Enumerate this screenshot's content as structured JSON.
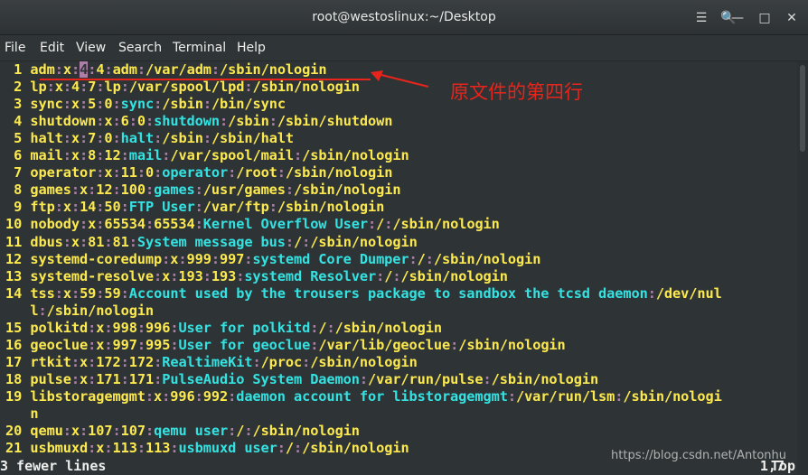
{
  "window": {
    "title": "root@westoslinux:~/Desktop",
    "controls": [
      "search-icon",
      "menu-icon",
      "minimize-icon",
      "maximize-icon",
      "close-icon"
    ]
  },
  "menu": [
    "File",
    "Edit",
    "View",
    "Search",
    "Terminal",
    "Help"
  ],
  "annotation": {
    "text": "原文件的第四行",
    "color": "#e8241b"
  },
  "lines": [
    {
      "n": "1",
      "parts": [
        [
          "adm",
          "user"
        ],
        [
          ":",
          "col"
        ],
        [
          "x",
          "user"
        ],
        [
          ":",
          "col"
        ],
        [
          "4",
          "cursor"
        ],
        [
          ":",
          "col"
        ],
        [
          "4",
          "user"
        ],
        [
          ":",
          "col"
        ],
        [
          "adm",
          "user"
        ],
        [
          ":",
          "col"
        ],
        [
          "/var/adm",
          "user"
        ],
        [
          ":",
          "col"
        ],
        [
          "/sbin/nologin",
          "user"
        ]
      ]
    },
    {
      "n": "2",
      "parts": [
        [
          "lp",
          "user"
        ],
        [
          ":",
          "col"
        ],
        [
          "x",
          "user"
        ],
        [
          ":",
          "col"
        ],
        [
          "4",
          "user"
        ],
        [
          ":",
          "col"
        ],
        [
          "7",
          "user"
        ],
        [
          ":",
          "col"
        ],
        [
          "lp",
          "user"
        ],
        [
          ":",
          "col"
        ],
        [
          "/var/spool/lpd",
          "user"
        ],
        [
          ":",
          "col"
        ],
        [
          "/sbin/nologin",
          "user"
        ]
      ]
    },
    {
      "n": "3",
      "parts": [
        [
          "sync",
          "user"
        ],
        [
          ":",
          "col"
        ],
        [
          "x",
          "user"
        ],
        [
          ":",
          "col"
        ],
        [
          "5",
          "user"
        ],
        [
          ":",
          "col"
        ],
        [
          "0",
          "user"
        ],
        [
          ":",
          "col"
        ],
        [
          "sync",
          "text"
        ],
        [
          ":",
          "col"
        ],
        [
          "/sbin",
          "user"
        ],
        [
          ":",
          "col"
        ],
        [
          "/bin/sync",
          "user"
        ]
      ]
    },
    {
      "n": "4",
      "parts": [
        [
          "shutdown",
          "user"
        ],
        [
          ":",
          "col"
        ],
        [
          "x",
          "user"
        ],
        [
          ":",
          "col"
        ],
        [
          "6",
          "user"
        ],
        [
          ":",
          "col"
        ],
        [
          "0",
          "user"
        ],
        [
          ":",
          "col"
        ],
        [
          "shutdown",
          "text"
        ],
        [
          ":",
          "col"
        ],
        [
          "/sbin",
          "user"
        ],
        [
          ":",
          "col"
        ],
        [
          "/sbin/shutdown",
          "user"
        ]
      ]
    },
    {
      "n": "5",
      "parts": [
        [
          "halt",
          "user"
        ],
        [
          ":",
          "col"
        ],
        [
          "x",
          "user"
        ],
        [
          ":",
          "col"
        ],
        [
          "7",
          "user"
        ],
        [
          ":",
          "col"
        ],
        [
          "0",
          "user"
        ],
        [
          ":",
          "col"
        ],
        [
          "halt",
          "text"
        ],
        [
          ":",
          "col"
        ],
        [
          "/sbin",
          "user"
        ],
        [
          ":",
          "col"
        ],
        [
          "/sbin/halt",
          "user"
        ]
      ]
    },
    {
      "n": "6",
      "parts": [
        [
          "mail",
          "user"
        ],
        [
          ":",
          "col"
        ],
        [
          "x",
          "user"
        ],
        [
          ":",
          "col"
        ],
        [
          "8",
          "user"
        ],
        [
          ":",
          "col"
        ],
        [
          "12",
          "user"
        ],
        [
          ":",
          "col"
        ],
        [
          "mail",
          "text"
        ],
        [
          ":",
          "col"
        ],
        [
          "/var/spool/mail",
          "user"
        ],
        [
          ":",
          "col"
        ],
        [
          "/sbin/nologin",
          "user"
        ]
      ]
    },
    {
      "n": "7",
      "parts": [
        [
          "operator",
          "user"
        ],
        [
          ":",
          "col"
        ],
        [
          "x",
          "user"
        ],
        [
          ":",
          "col"
        ],
        [
          "11",
          "user"
        ],
        [
          ":",
          "col"
        ],
        [
          "0",
          "user"
        ],
        [
          ":",
          "col"
        ],
        [
          "operator",
          "text"
        ],
        [
          ":",
          "col"
        ],
        [
          "/root",
          "user"
        ],
        [
          ":",
          "col"
        ],
        [
          "/sbin/nologin",
          "user"
        ]
      ]
    },
    {
      "n": "8",
      "parts": [
        [
          "games",
          "user"
        ],
        [
          ":",
          "col"
        ],
        [
          "x",
          "user"
        ],
        [
          ":",
          "col"
        ],
        [
          "12",
          "user"
        ],
        [
          ":",
          "col"
        ],
        [
          "100",
          "user"
        ],
        [
          ":",
          "col"
        ],
        [
          "games",
          "text"
        ],
        [
          ":",
          "col"
        ],
        [
          "/usr/games",
          "user"
        ],
        [
          ":",
          "col"
        ],
        [
          "/sbin/nologin",
          "user"
        ]
      ]
    },
    {
      "n": "9",
      "parts": [
        [
          "ftp",
          "user"
        ],
        [
          ":",
          "col"
        ],
        [
          "x",
          "user"
        ],
        [
          ":",
          "col"
        ],
        [
          "14",
          "user"
        ],
        [
          ":",
          "col"
        ],
        [
          "50",
          "user"
        ],
        [
          ":",
          "col"
        ],
        [
          "FTP User",
          "text"
        ],
        [
          ":",
          "col"
        ],
        [
          "/var/ftp",
          "user"
        ],
        [
          ":",
          "col"
        ],
        [
          "/sbin/nologin",
          "user"
        ]
      ]
    },
    {
      "n": "10",
      "parts": [
        [
          "nobody",
          "user"
        ],
        [
          ":",
          "col"
        ],
        [
          "x",
          "user"
        ],
        [
          ":",
          "col"
        ],
        [
          "65534",
          "user"
        ],
        [
          ":",
          "col"
        ],
        [
          "65534",
          "user"
        ],
        [
          ":",
          "col"
        ],
        [
          "Kernel Overflow User",
          "text"
        ],
        [
          ":",
          "col"
        ],
        [
          "/",
          "user"
        ],
        [
          ":",
          "col"
        ],
        [
          "/sbin/nologin",
          "user"
        ]
      ]
    },
    {
      "n": "11",
      "parts": [
        [
          "dbus",
          "user"
        ],
        [
          ":",
          "col"
        ],
        [
          "x",
          "user"
        ],
        [
          ":",
          "col"
        ],
        [
          "81",
          "user"
        ],
        [
          ":",
          "col"
        ],
        [
          "81",
          "user"
        ],
        [
          ":",
          "col"
        ],
        [
          "System message bus",
          "text"
        ],
        [
          ":",
          "col"
        ],
        [
          "/",
          "user"
        ],
        [
          ":",
          "col"
        ],
        [
          "/sbin/nologin",
          "user"
        ]
      ]
    },
    {
      "n": "12",
      "parts": [
        [
          "systemd-coredump",
          "user"
        ],
        [
          ":",
          "col"
        ],
        [
          "x",
          "user"
        ],
        [
          ":",
          "col"
        ],
        [
          "999",
          "user"
        ],
        [
          ":",
          "col"
        ],
        [
          "997",
          "user"
        ],
        [
          ":",
          "col"
        ],
        [
          "systemd Core Dumper",
          "text"
        ],
        [
          ":",
          "col"
        ],
        [
          "/",
          "user"
        ],
        [
          ":",
          "col"
        ],
        [
          "/sbin/nologin",
          "user"
        ]
      ]
    },
    {
      "n": "13",
      "parts": [
        [
          "systemd-resolve",
          "user"
        ],
        [
          ":",
          "col"
        ],
        [
          "x",
          "user"
        ],
        [
          ":",
          "col"
        ],
        [
          "193",
          "user"
        ],
        [
          ":",
          "col"
        ],
        [
          "193",
          "user"
        ],
        [
          ":",
          "col"
        ],
        [
          "systemd Resolver",
          "text"
        ],
        [
          ":",
          "col"
        ],
        [
          "/",
          "user"
        ],
        [
          ":",
          "col"
        ],
        [
          "/sbin/nologin",
          "user"
        ]
      ]
    },
    {
      "n": "14",
      "parts": [
        [
          "tss",
          "user"
        ],
        [
          ":",
          "col"
        ],
        [
          "x",
          "user"
        ],
        [
          ":",
          "col"
        ],
        [
          "59",
          "user"
        ],
        [
          ":",
          "col"
        ],
        [
          "59",
          "user"
        ],
        [
          ":",
          "col"
        ],
        [
          "Account used by the trousers package to sandbox the tcsd daemon",
          "text"
        ],
        [
          ":",
          "col"
        ],
        [
          "/dev/nul",
          "user"
        ]
      ]
    },
    {
      "n": "",
      "parts": [
        [
          "l",
          "user"
        ],
        [
          ":",
          "col"
        ],
        [
          "/sbin/nologin",
          "user"
        ]
      ]
    },
    {
      "n": "15",
      "parts": [
        [
          "polkitd",
          "user"
        ],
        [
          ":",
          "col"
        ],
        [
          "x",
          "user"
        ],
        [
          ":",
          "col"
        ],
        [
          "998",
          "user"
        ],
        [
          ":",
          "col"
        ],
        [
          "996",
          "user"
        ],
        [
          ":",
          "col"
        ],
        [
          "User for polkitd",
          "text"
        ],
        [
          ":",
          "col"
        ],
        [
          "/",
          "user"
        ],
        [
          ":",
          "col"
        ],
        [
          "/sbin/nologin",
          "user"
        ]
      ]
    },
    {
      "n": "16",
      "parts": [
        [
          "geoclue",
          "user"
        ],
        [
          ":",
          "col"
        ],
        [
          "x",
          "user"
        ],
        [
          ":",
          "col"
        ],
        [
          "997",
          "user"
        ],
        [
          ":",
          "col"
        ],
        [
          "995",
          "user"
        ],
        [
          ":",
          "col"
        ],
        [
          "User for geoclue",
          "text"
        ],
        [
          ":",
          "col"
        ],
        [
          "/var/lib/geoclue",
          "user"
        ],
        [
          ":",
          "col"
        ],
        [
          "/sbin/nologin",
          "user"
        ]
      ]
    },
    {
      "n": "17",
      "parts": [
        [
          "rtkit",
          "user"
        ],
        [
          ":",
          "col"
        ],
        [
          "x",
          "user"
        ],
        [
          ":",
          "col"
        ],
        [
          "172",
          "user"
        ],
        [
          ":",
          "col"
        ],
        [
          "172",
          "user"
        ],
        [
          ":",
          "col"
        ],
        [
          "RealtimeKit",
          "text"
        ],
        [
          ":",
          "col"
        ],
        [
          "/proc",
          "user"
        ],
        [
          ":",
          "col"
        ],
        [
          "/sbin/nologin",
          "user"
        ]
      ]
    },
    {
      "n": "18",
      "parts": [
        [
          "pulse",
          "user"
        ],
        [
          ":",
          "col"
        ],
        [
          "x",
          "user"
        ],
        [
          ":",
          "col"
        ],
        [
          "171",
          "user"
        ],
        [
          ":",
          "col"
        ],
        [
          "171",
          "user"
        ],
        [
          ":",
          "col"
        ],
        [
          "PulseAudio System Daemon",
          "text"
        ],
        [
          ":",
          "col"
        ],
        [
          "/var/run/pulse",
          "user"
        ],
        [
          ":",
          "col"
        ],
        [
          "/sbin/nologin",
          "user"
        ]
      ]
    },
    {
      "n": "19",
      "parts": [
        [
          "libstoragemgmt",
          "user"
        ],
        [
          ":",
          "col"
        ],
        [
          "x",
          "user"
        ],
        [
          ":",
          "col"
        ],
        [
          "996",
          "user"
        ],
        [
          ":",
          "col"
        ],
        [
          "992",
          "user"
        ],
        [
          ":",
          "col"
        ],
        [
          "daemon account for libstoragemgmt",
          "text"
        ],
        [
          ":",
          "col"
        ],
        [
          "/var/run/lsm",
          "user"
        ],
        [
          ":",
          "col"
        ],
        [
          "/sbin/nologi",
          "user"
        ]
      ]
    },
    {
      "n": "",
      "parts": [
        [
          "n",
          "user"
        ]
      ]
    },
    {
      "n": "20",
      "parts": [
        [
          "qemu",
          "user"
        ],
        [
          ":",
          "col"
        ],
        [
          "x",
          "user"
        ],
        [
          ":",
          "col"
        ],
        [
          "107",
          "user"
        ],
        [
          ":",
          "col"
        ],
        [
          "107",
          "user"
        ],
        [
          ":",
          "col"
        ],
        [
          "qemu user",
          "text"
        ],
        [
          ":",
          "col"
        ],
        [
          "/",
          "user"
        ],
        [
          ":",
          "col"
        ],
        [
          "/sbin/nologin",
          "user"
        ]
      ]
    },
    {
      "n": "21",
      "parts": [
        [
          "usbmuxd",
          "user"
        ],
        [
          ":",
          "col"
        ],
        [
          "x",
          "user"
        ],
        [
          ":",
          "col"
        ],
        [
          "113",
          "user"
        ],
        [
          ":",
          "col"
        ],
        [
          "113",
          "user"
        ],
        [
          ":",
          "col"
        ],
        [
          "usbmuxd user",
          "text"
        ],
        [
          ":",
          "col"
        ],
        [
          "/",
          "user"
        ],
        [
          ":",
          "col"
        ],
        [
          "/sbin/nologin",
          "user"
        ]
      ]
    }
  ],
  "status": {
    "left": "3 fewer lines",
    "pos": "1,7",
    "top": "Top"
  },
  "watermark": "https://blog.csdn.net/Antonhu"
}
